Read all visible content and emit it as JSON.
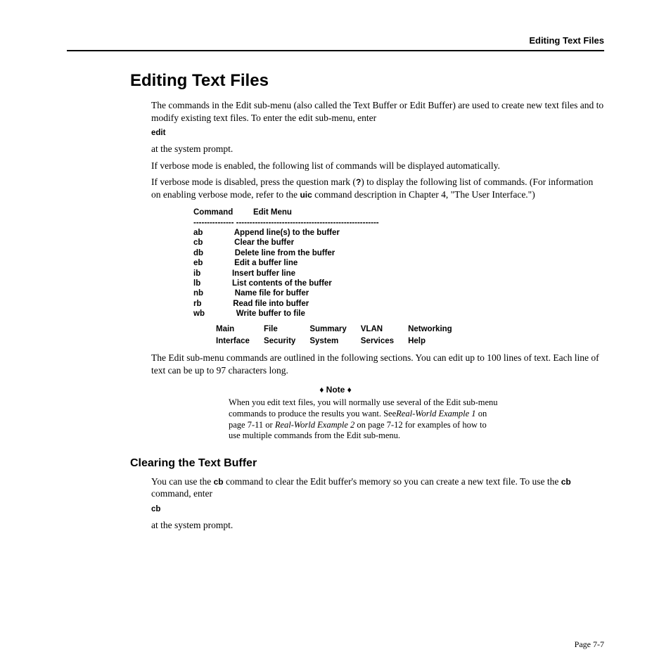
{
  "running_head": "Editing Text Files",
  "h1": "Editing Text Files",
  "p1": "The commands in the Edit sub-menu (also called the Text Buffer or Edit Buffer) are used to create new text files and to modify existing text files. To enter the edit sub-menu, enter",
  "cmd_edit": "edit",
  "p2": "at the system prompt.",
  "p3": "If verbose mode is enabled, the following list of commands will be displayed automatically.",
  "p4a": "If verbose mode is disabled, press the question mark (",
  "p4_q": "?",
  "p4b": ") to display the following list of commands. (For information on enabling verbose mode, refer to the ",
  "p4_uic": "uic",
  "p4c": " command description in Chapter 4, \"The User Interface.\")",
  "table": {
    "hdr_cmd": "Command",
    "hdr_menu": "Edit Menu",
    "sep_cmd": "---------------",
    "sep_menu": "-----------------------------------------------------",
    "rows": [
      {
        "c": "ab",
        "d": "Append line(s) to the buffer"
      },
      {
        "c": "cb",
        "d": "Clear the buffer"
      },
      {
        "c": "db",
        "d": "Delete line from the buffer"
      },
      {
        "c": "eb",
        "d": "Edit a buffer line"
      },
      {
        "c": "ib",
        "d": "Insert buffer line"
      },
      {
        "c": "lb",
        "d": "List contents of the buffer"
      },
      {
        "c": "nb",
        "d": "Name file for buffer"
      },
      {
        "c": "rb",
        "d": "Read file into buffer"
      },
      {
        "c": "wb",
        "d": "Write buffer to file"
      }
    ]
  },
  "footer": {
    "r1": [
      "Main",
      "File",
      "Summary",
      "VLAN",
      "Networking"
    ],
    "r2": [
      "Interface",
      "Security",
      "System",
      "Services",
      "Help"
    ]
  },
  "p5": "The Edit sub-menu commands are outlined in the following sections. You can edit up to 100 lines of text. Each line of text can be up to 97 characters long.",
  "note_heading": "♦ Note ♦",
  "note_a": "When you edit text files, you will normally use several of the Edit sub-menu commands to produce the results you want. See",
  "note_ex1": "Real-World Example 1",
  "note_b": " on page 7-11 or ",
  "note_ex2": "Real-World Example 2",
  "note_c": " on page 7-12 for examples of how to use multiple commands from the Edit sub-menu.",
  "h2": "Clearing the Text Buffer",
  "p6a": "You can use the ",
  "p6_cb1": "cb",
  "p6b": " command to clear the Edit buffer's memory so you can create a new text file. To use the ",
  "p6_cb2": "cb",
  "p6c": " command, enter",
  "cmd_cb": "cb",
  "p7": "at the system prompt.",
  "page_number": "Page 7-7"
}
